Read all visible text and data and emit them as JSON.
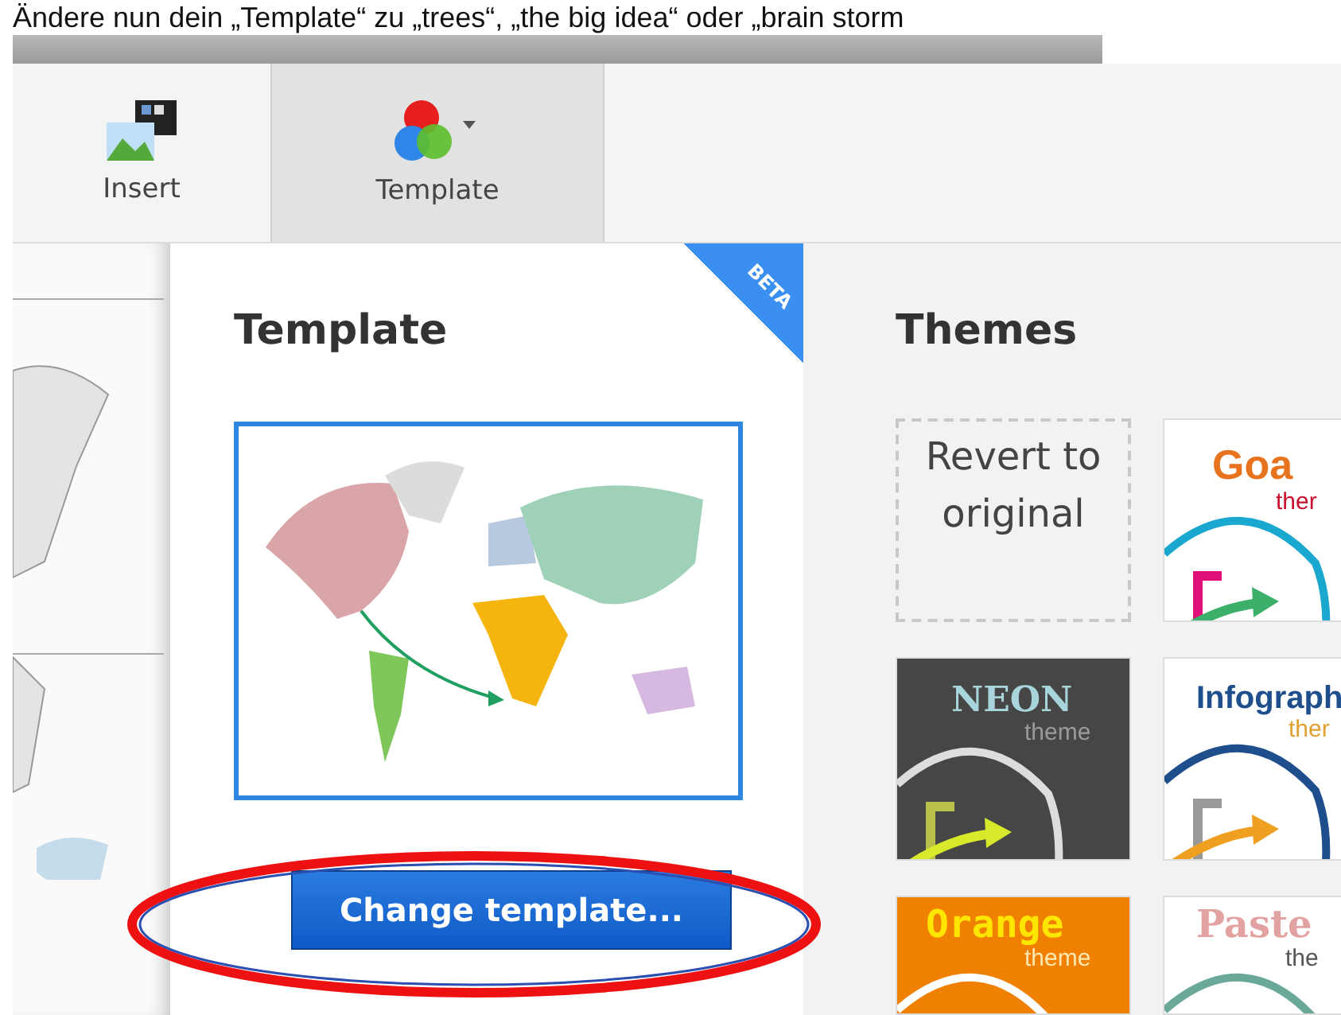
{
  "caption": "Ändere nun dein „Template“ zu „trees“, „the big idea“ oder „brain storm",
  "toolbar": {
    "buttons": [
      {
        "kind": "insert",
        "label": "Insert",
        "selected": false
      },
      {
        "kind": "template",
        "label": "Template",
        "selected": true
      }
    ]
  },
  "template_panel": {
    "heading": "Template",
    "badge": "BETA",
    "button": "Change template..."
  },
  "themes_panel": {
    "heading": "Themes",
    "tiles": [
      {
        "kind": "revert",
        "label": "Revert to original"
      },
      {
        "kind": "goa",
        "title": "Goa",
        "subtitle": "ther",
        "color": "#e8731f"
      },
      {
        "kind": "neon",
        "title": "NEON",
        "subtitle": "theme",
        "color": "#a8d4dc"
      },
      {
        "kind": "infographic",
        "title": "Infograph",
        "subtitle": "ther",
        "color": "#1f4e8c"
      },
      {
        "kind": "orange",
        "title": "Orange",
        "subtitle": "theme",
        "color": "#ffe600"
      },
      {
        "kind": "pastel",
        "title": "Paste",
        "subtitle": "the",
        "color": "#e3a2a2"
      }
    ]
  }
}
